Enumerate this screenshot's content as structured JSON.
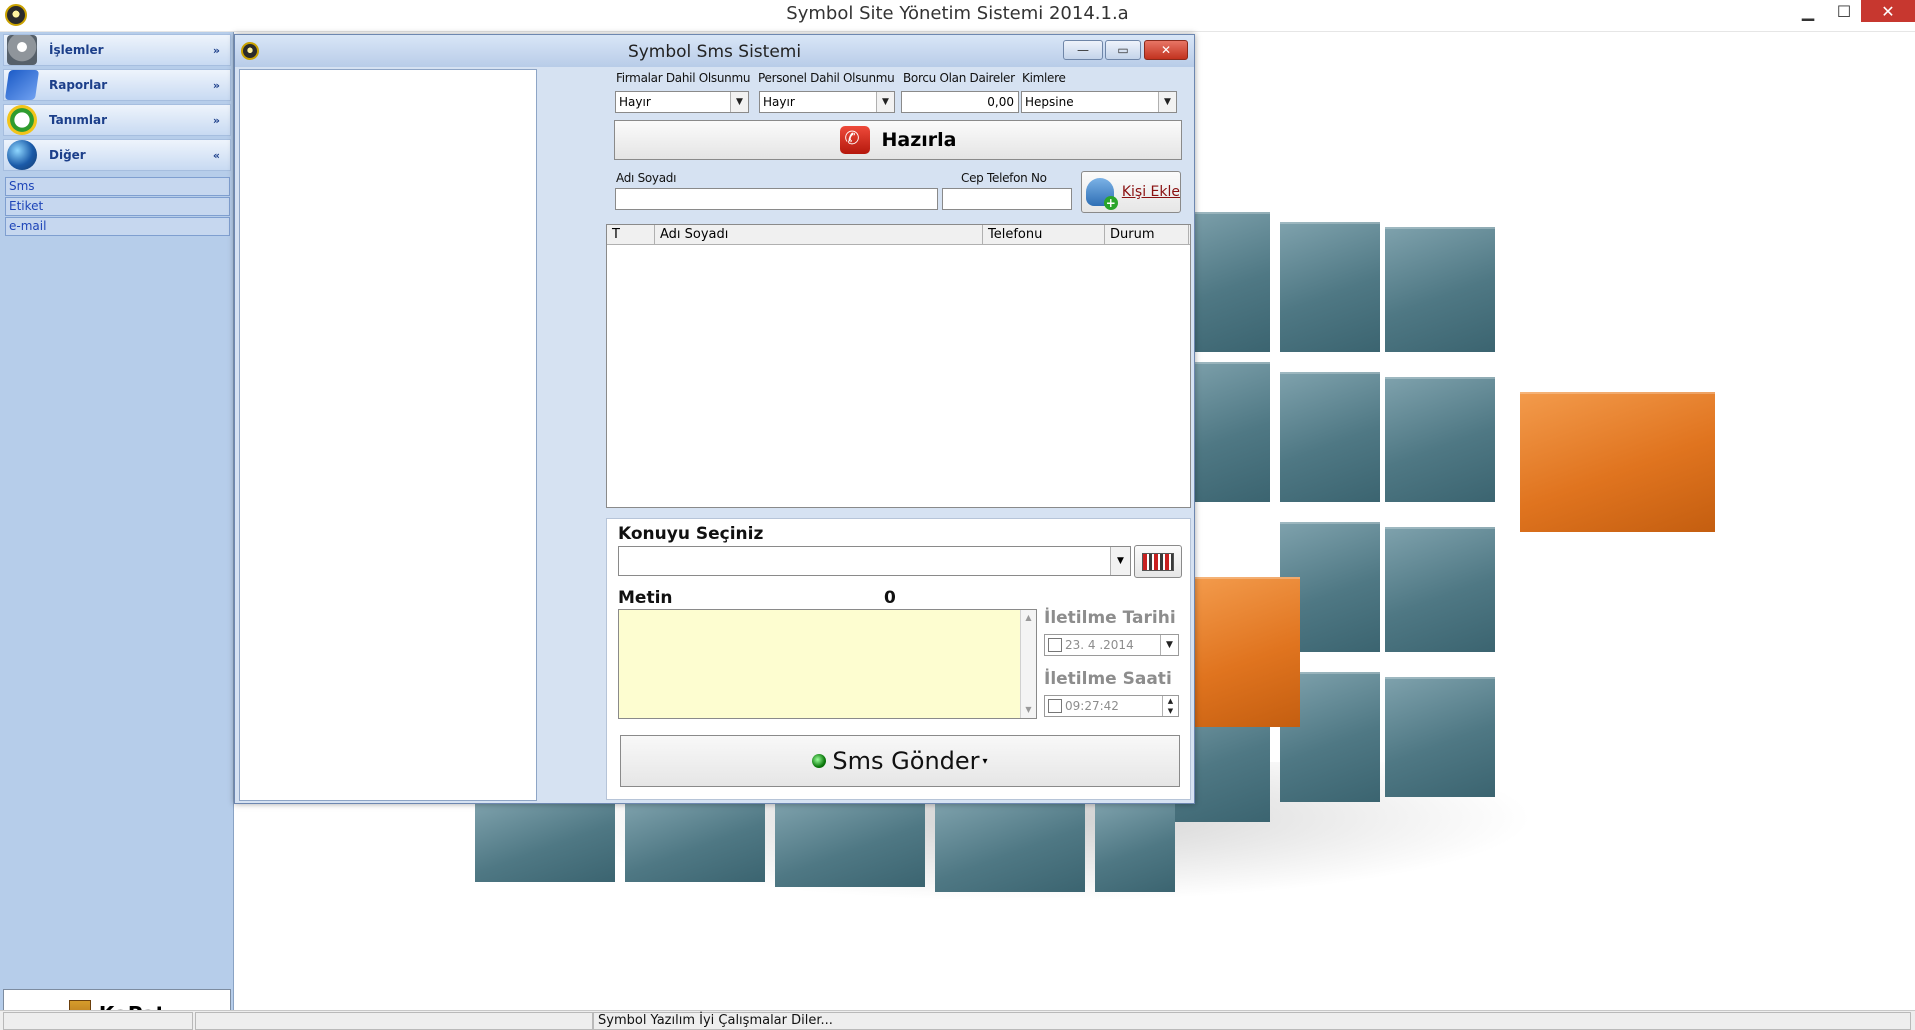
{
  "app": {
    "title": "Symbol Site Yönetim Sistemi 2014.1.a",
    "window_controls": {
      "minimize": "▁",
      "maximize": "☐",
      "close": "✕"
    }
  },
  "sidebar": {
    "groups": [
      {
        "label": "İşlemler",
        "icon": "gear-icon",
        "chevron": "»",
        "expanded": false
      },
      {
        "label": "Raporlar",
        "icon": "book-icon",
        "chevron": "»",
        "expanded": false
      },
      {
        "label": "Tanımlar",
        "icon": "clock-icon",
        "chevron": "»",
        "expanded": false
      },
      {
        "label": "Diğer",
        "icon": "globe-icon",
        "chevron": "«",
        "expanded": true
      }
    ],
    "sub_items": [
      "Sms",
      "Etiket",
      "e-mail"
    ],
    "close_button": "KaPat"
  },
  "sms_window": {
    "title": "Symbol Sms Sistemi",
    "controls": {
      "minimize": "—",
      "maximize": "▭",
      "close": "✕"
    },
    "filters": {
      "firmalar": {
        "label": "Firmalar Dahil Olsunmu",
        "value": "Hayır"
      },
      "personel": {
        "label": "Personel Dahil Olsunmu",
        "value": "Hayır"
      },
      "borclu": {
        "label": "Borcu Olan Daireler",
        "value": "0,00"
      },
      "kimlere": {
        "label": "Kimlere",
        "value": "Hepsine"
      }
    },
    "hazirla_button": "Hazırla",
    "contact": {
      "name_label": "Adı Soyadı",
      "name_value": "",
      "phone_label": "Cep Telefon No",
      "phone_value": "",
      "add_button": "Kişi Ekle"
    },
    "grid": {
      "columns": [
        "T",
        "Adı Soyadı",
        "Telefonu",
        "Durum"
      ],
      "rows": []
    },
    "konu_label": "Konuyu Seçiniz",
    "konu_value": "",
    "metin_label": "Metin",
    "metin_count": "0",
    "metin_value": "",
    "iletilme_tarihi_label": "İletilme Tarihi",
    "iletilme_tarihi_value": "23. 4 .2014",
    "iletilme_saati_label": "İletilme Saati",
    "iletilme_saati_value": "09:27:42",
    "send_button": "Sms Gönder"
  },
  "statusbar": {
    "message": "Symbol Yazılım İyi Çalışmalar Diler..."
  },
  "colors": {
    "sidebar_bg": "#b6cdea",
    "window_bg": "#d6e2f2",
    "metin_bg": "#fdfdd0",
    "close_red": "#c7372f",
    "cube_teal": "#4f7884",
    "cube_orange": "#e0741f"
  }
}
